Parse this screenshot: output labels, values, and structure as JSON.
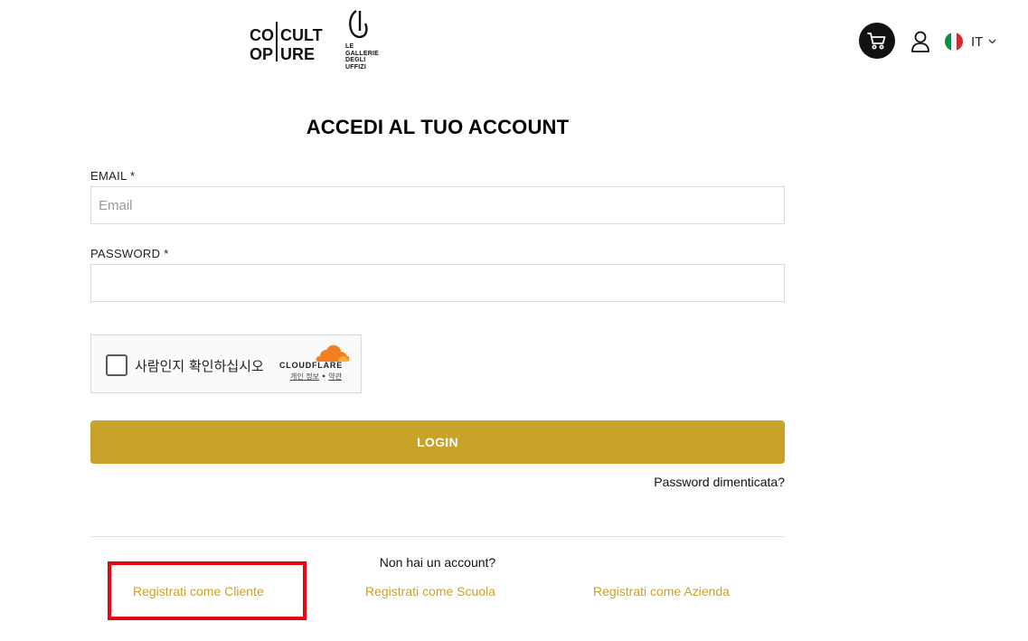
{
  "header": {
    "logo_coop_lines": [
      "CO",
      "OP",
      "CULT",
      "URE"
    ],
    "logo_uffizi_lines": [
      "LE",
      "GALLERIE",
      "DEGLI",
      "UFFIZI"
    ],
    "language_code": "IT",
    "cart_icon": "cart-icon",
    "user_icon": "user-icon",
    "flag_colors": [
      "#009246",
      "#ffffff",
      "#ce2b37"
    ]
  },
  "page": {
    "title": "ACCEDI AL TUO ACCOUNT"
  },
  "form": {
    "email_label": "EMAIL *",
    "email_placeholder": "Email",
    "email_value": "",
    "password_label": "PASSWORD *",
    "password_value": "",
    "login_label": "LOGIN",
    "forgot_label": "Password dimenticata?"
  },
  "captcha": {
    "prompt": "사람인지 확인하십시오",
    "brand": "CLOUDFLARE",
    "privacy_link": "개인 정보",
    "separator": "•",
    "terms_link": "약관",
    "brand_color": "#f38020"
  },
  "register": {
    "question": "Non hai un account?",
    "client_link": "Registrati come Cliente",
    "school_link": "Registrati come Scuola",
    "company_link": "Registrati come Azienda"
  },
  "colors": {
    "accent": "#c9a22a",
    "highlight": "#e30613"
  }
}
